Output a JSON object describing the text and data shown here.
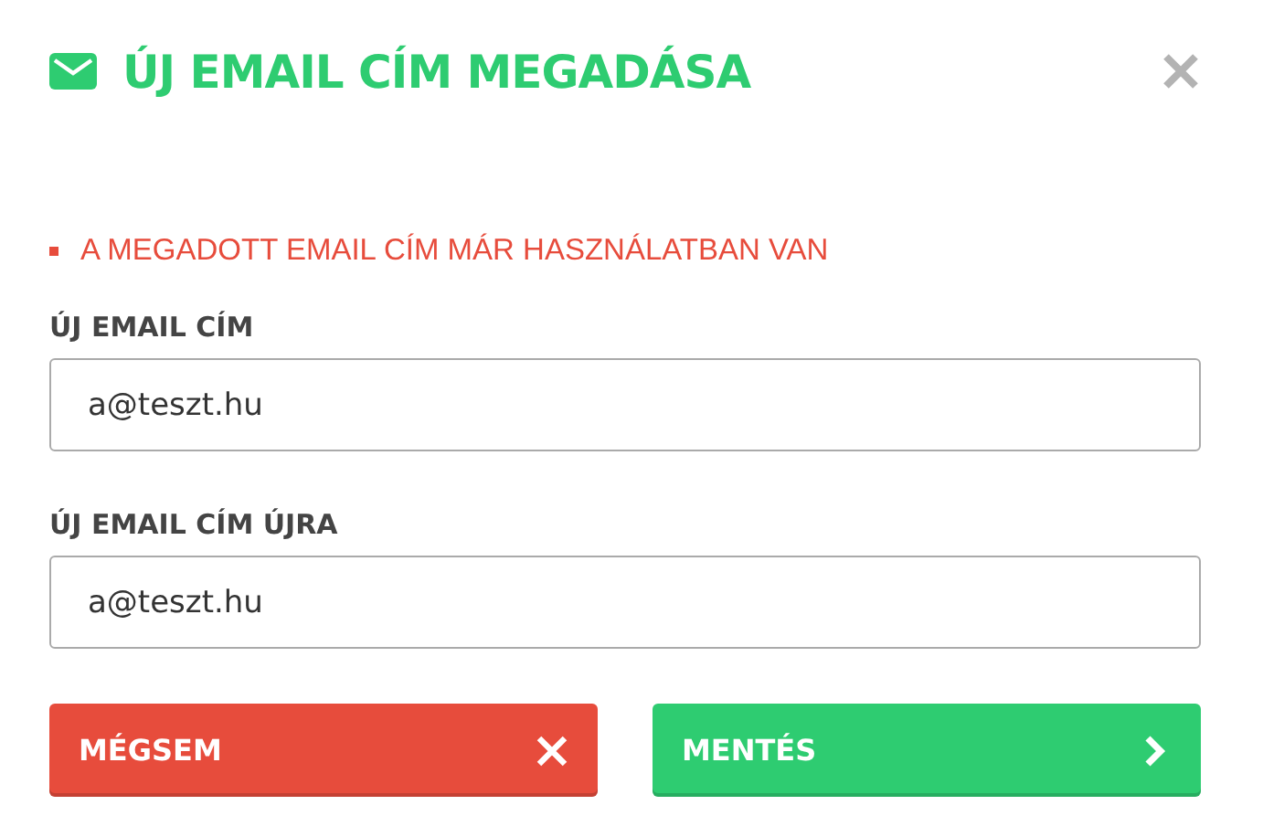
{
  "dialog": {
    "title": "ÚJ EMAIL CÍM MEGADÁSA"
  },
  "errors": [
    "A MEGADOTT EMAIL CÍM MÁR HASZNÁLATBAN VAN"
  ],
  "fields": [
    {
      "label": "ÚJ EMAIL CÍM",
      "value": "a@teszt.hu"
    },
    {
      "label": "ÚJ EMAIL CÍM ÚJRA",
      "value": "a@teszt.hu"
    }
  ],
  "buttons": [
    {
      "label": "MÉGSEM",
      "kind": "cancel"
    },
    {
      "label": "MENTÉS",
      "kind": "save"
    }
  ]
}
